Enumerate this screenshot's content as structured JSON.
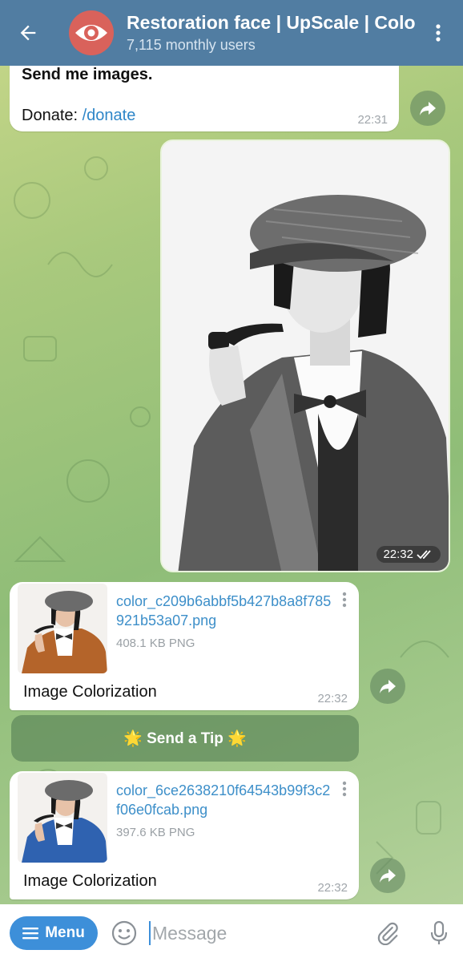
{
  "header": {
    "title": "Restoration face | UpScale | Colorization",
    "subtitle": "7,115 monthly users"
  },
  "messages": {
    "intro": {
      "line1": "Send me images.",
      "donate_prefix": "Donate: ",
      "donate_link": "/donate",
      "time": "22:31"
    },
    "sent_photo": {
      "time": "22:32",
      "status": "read"
    },
    "file1": {
      "name": "color_c209b6abbf5b427b8a8f785921b53a07.png",
      "size": "408.1 KB PNG",
      "caption": "Image Colorization",
      "time": "22:32"
    },
    "tip_button": "🌟 Send a Tip 🌟",
    "file2": {
      "name": "color_6ce2638210f64543b99f3c2f06e0fcab.png",
      "size": "397.6 KB PNG",
      "caption": "Image Colorization",
      "time": "22:32"
    }
  },
  "composer": {
    "menu_label": "Menu",
    "placeholder": "Message"
  },
  "colors": {
    "header": "#517da2",
    "accent": "#3d8fd9",
    "link": "#2e86c8",
    "avatar": "#d9625b"
  }
}
